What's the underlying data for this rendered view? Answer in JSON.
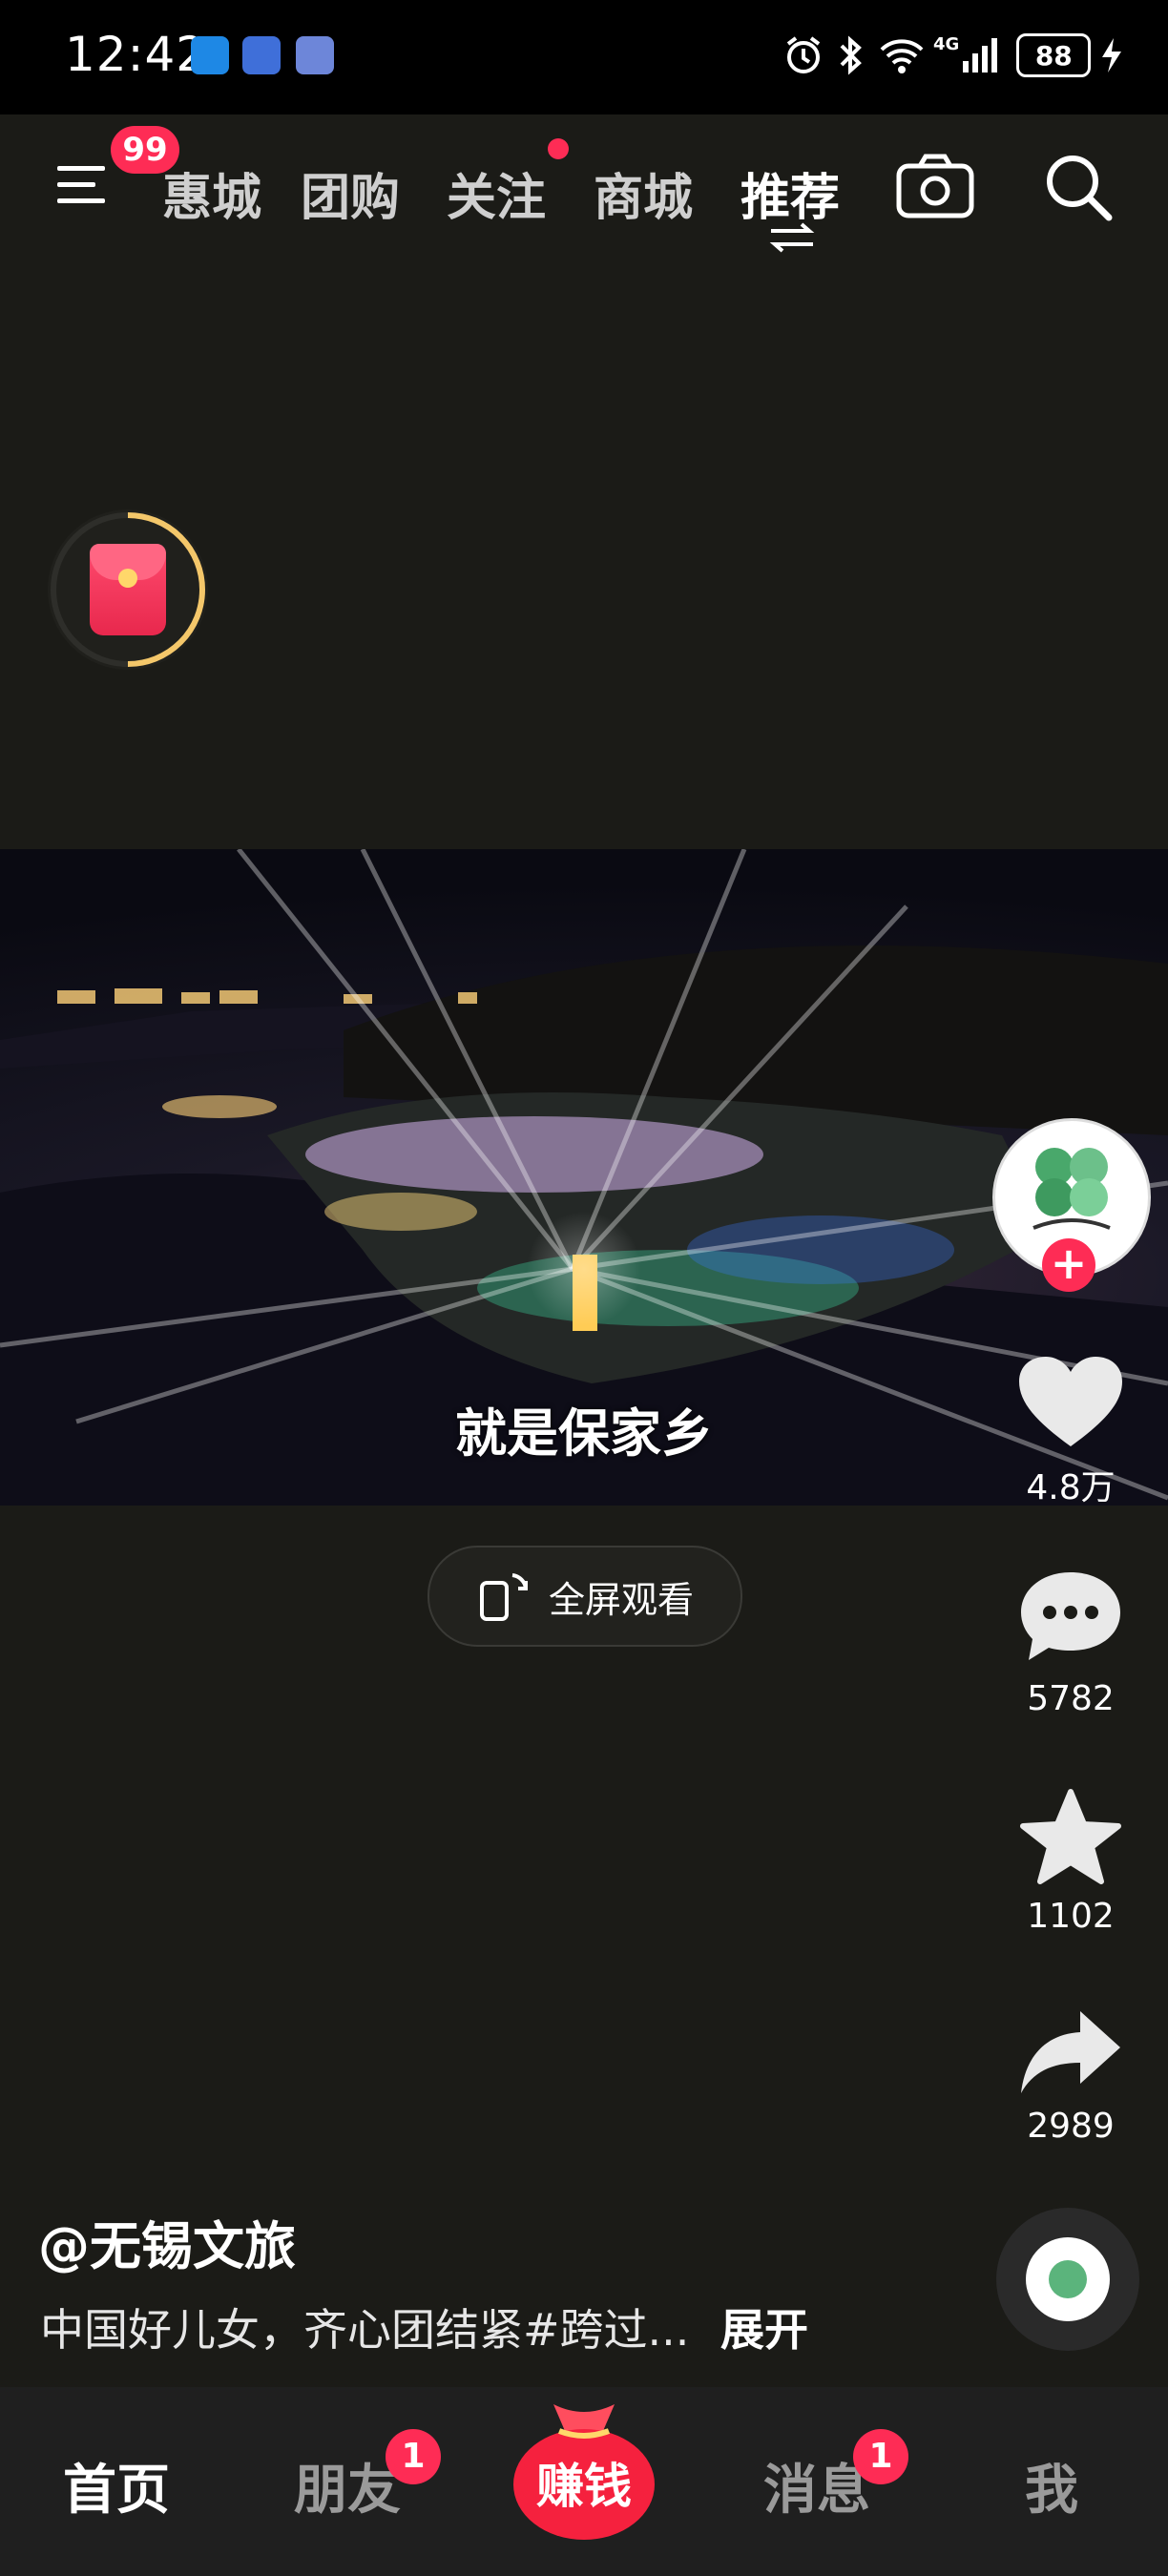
{
  "status_bar": {
    "time": "12:42",
    "network": "4G",
    "battery": "88"
  },
  "top_nav": {
    "menu_badge": "99",
    "tabs": [
      "惠城",
      "团购",
      "关注",
      "商城",
      "推荐"
    ],
    "active_tab": "推荐"
  },
  "video": {
    "subtitle": "就是保家乡"
  },
  "fullscreen_label": "全屏观看",
  "side_actions": {
    "likes": "4.8万",
    "comments": "5782",
    "favorites": "1102",
    "shares": "2989"
  },
  "post": {
    "author": "@无锡文旅",
    "caption": "中国好儿女，齐心团结紧#跨过...",
    "expand": "展开"
  },
  "bottom_nav": {
    "home": "首页",
    "friends": "朋友",
    "friends_badge": "1",
    "earn": "赚钱",
    "messages": "消息",
    "messages_badge": "1",
    "me": "我"
  },
  "colors": {
    "accent": "#fe2c55",
    "background": "#1b1b17",
    "ring": "#f4c76a"
  }
}
